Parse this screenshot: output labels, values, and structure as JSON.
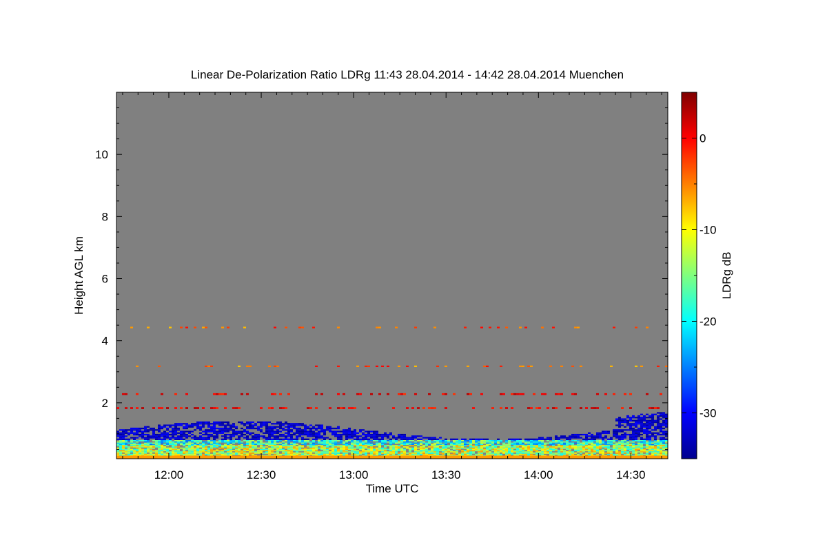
{
  "chart_data": {
    "type": "heatmap",
    "title": "Linear De-Polarization Ratio LDRg   11:43 28.04.2014 - 14:42 28.04.2014 Muenchen",
    "xlabel": "Time UTC",
    "ylabel": "Height AGL km",
    "x_range": [
      "11:43",
      "14:42"
    ],
    "ylim": [
      0.2,
      12
    ],
    "x_ticks": [
      "12:00",
      "12:30",
      "13:00",
      "13:30",
      "14:00",
      "14:30"
    ],
    "y_ticks": [
      2,
      4,
      6,
      8,
      10
    ],
    "colorbar": {
      "label": "LDRg dB",
      "range": [
        -35,
        5
      ],
      "ticks": [
        0,
        -10,
        -20,
        -30
      ],
      "colormap": "jet"
    },
    "background_color": "#808080",
    "features": [
      {
        "name": "ground aerosol layer",
        "height_km": [
          0.2,
          0.8
        ],
        "ldr_db": -15
      },
      {
        "name": "blue layer",
        "height_km": [
          0.8,
          1.8
        ],
        "ldr_db": -32
      },
      {
        "name": "red streaks",
        "height_km": [
          1.6,
          2.4
        ],
        "ldr_db": 0
      },
      {
        "name": "sparse returns",
        "height_km": [
          3.0,
          4.5
        ],
        "ldr_db": -5
      }
    ]
  }
}
